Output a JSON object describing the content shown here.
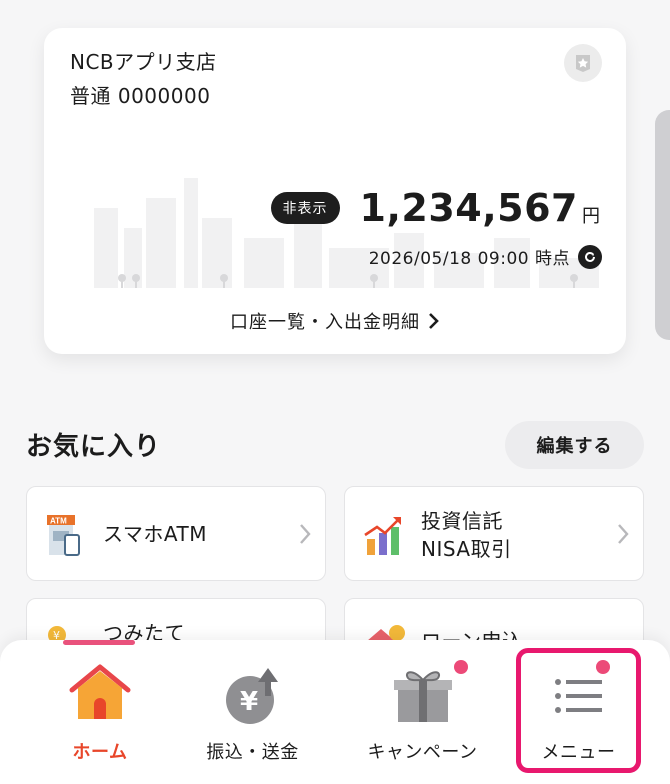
{
  "account": {
    "branch": "NCBアプリ支店",
    "type_and_number": "普通 0000000",
    "hide_label": "非表示",
    "balance": "1,234,567",
    "currency": "円",
    "as_of": "2026/05/18 09:00 時点",
    "detail_link": "口座一覧・入出金明細"
  },
  "favorites": {
    "title": "お気に入り",
    "edit_label": "編集する",
    "tiles": [
      {
        "line1": "スマホATM",
        "line2": "",
        "icon": "smartphone-atm-icon"
      },
      {
        "line1": "投資信託",
        "line2": "NISA取引",
        "icon": "investment-chart-icon"
      },
      {
        "line1": "つみたて",
        "line2": "",
        "icon": "savings-coins-icon"
      },
      {
        "line1": "ローン申込",
        "line2": "",
        "icon": "loan-house-icon"
      }
    ]
  },
  "nav": {
    "home": "ホーム",
    "transfer": "振込・送金",
    "campaign": "キャンペーン",
    "menu": "メニュー"
  },
  "colors": {
    "accent_red": "#e8462a",
    "badge_pink": "#ec4a78",
    "highlight_magenta": "#e8186e"
  }
}
